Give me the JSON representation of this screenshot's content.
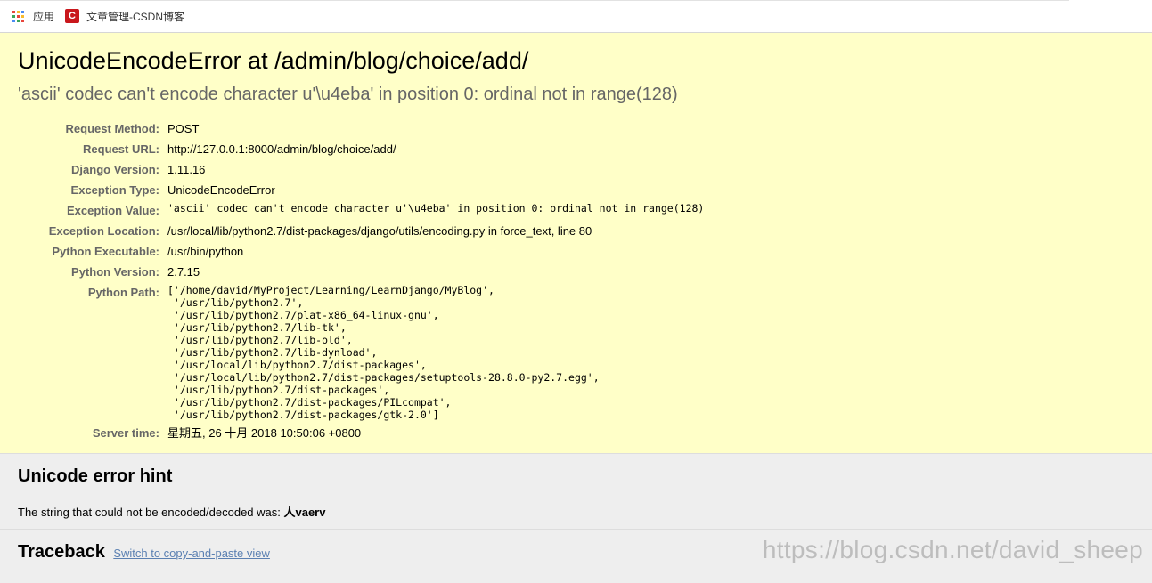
{
  "bookmarks": {
    "apps_label": "应用",
    "csdn_label": "文章管理-CSDN博客",
    "csdn_icon_letter": "C"
  },
  "summary": {
    "title": "UnicodeEncodeError at /admin/blog/choice/add/",
    "subtitle": "'ascii' codec can't encode character u'\\u4eba' in position 0: ordinal not in range(128)",
    "rows": {
      "request_method": {
        "label": "Request Method:",
        "value": "POST"
      },
      "request_url": {
        "label": "Request URL:",
        "value": "http://127.0.0.1:8000/admin/blog/choice/add/"
      },
      "django_version": {
        "label": "Django Version:",
        "value": "1.11.16"
      },
      "exception_type": {
        "label": "Exception Type:",
        "value": "UnicodeEncodeError"
      },
      "exception_value": {
        "label": "Exception Value:",
        "value": "'ascii' codec can't encode character u'\\u4eba' in position 0: ordinal not in range(128)"
      },
      "exception_location": {
        "label": "Exception Location:",
        "value": "/usr/local/lib/python2.7/dist-packages/django/utils/encoding.py in force_text, line 80"
      },
      "python_executable": {
        "label": "Python Executable:",
        "value": "/usr/bin/python"
      },
      "python_version": {
        "label": "Python Version:",
        "value": "2.7.15"
      },
      "python_path": {
        "label": "Python Path:",
        "value": "['/home/david/MyProject/Learning/LearnDjango/MyBlog',\n '/usr/lib/python2.7',\n '/usr/lib/python2.7/plat-x86_64-linux-gnu',\n '/usr/lib/python2.7/lib-tk',\n '/usr/lib/python2.7/lib-old',\n '/usr/lib/python2.7/lib-dynload',\n '/usr/local/lib/python2.7/dist-packages',\n '/usr/local/lib/python2.7/dist-packages/setuptools-28.8.0-py2.7.egg',\n '/usr/lib/python2.7/dist-packages',\n '/usr/lib/python2.7/dist-packages/PILcompat',\n '/usr/lib/python2.7/dist-packages/gtk-2.0']"
      },
      "server_time": {
        "label": "Server time:",
        "value": "星期五, 26 十月 2018 10:50:06 +0800"
      }
    }
  },
  "unicode_hint": {
    "heading": "Unicode error hint",
    "text": "The string that could not be encoded/decoded was: ",
    "string": "人vaerv"
  },
  "traceback": {
    "heading": "Traceback",
    "link": "Switch to copy-and-paste view"
  },
  "watermark": "https://blog.csdn.net/david_sheep",
  "colors": {
    "summary_bg": "#ffffc8",
    "section_bg": "#eeeeee",
    "link": "#5b80b2",
    "csdn_red": "#c9171c"
  }
}
